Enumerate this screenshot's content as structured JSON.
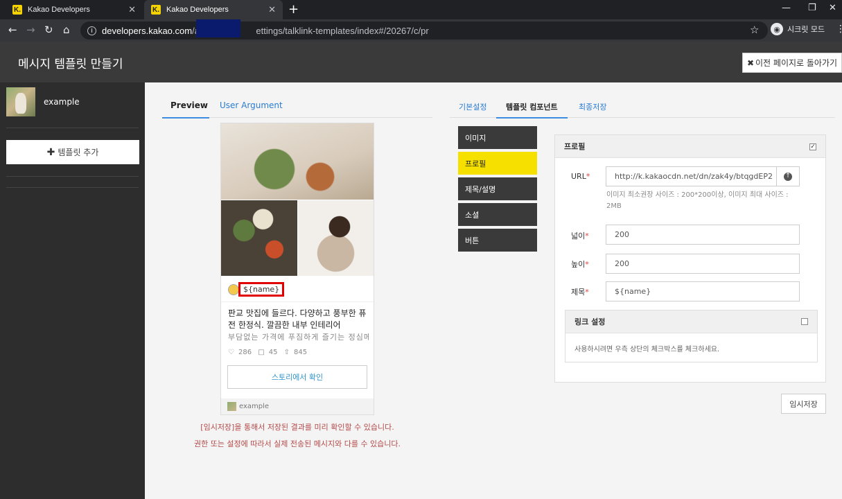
{
  "browser": {
    "tabs": [
      {
        "favicon": "K.",
        "title": "Kakao Developers",
        "close": "✕"
      },
      {
        "favicon": "K.",
        "title": "Kakao Developers",
        "close": "✕"
      }
    ],
    "new_tab": "+",
    "url_host": "developers.kakao.com",
    "url_path_start": "/app",
    "url_path_end": "ettings/talklink-templates/index#/20267/c/pr",
    "incognito_label": "시크릿 모드"
  },
  "header": {
    "title": "메시지 템플릿 만들기",
    "back_button": "이전 페이지로 돌아가기"
  },
  "sidebar": {
    "user_name": "example",
    "add_template": "템플릿 추가"
  },
  "preview": {
    "tabs": [
      "Preview",
      "User Argument"
    ],
    "profile_name": "${name}",
    "title": "판교 맛집에 들르다. 다양하고 풍부한 퓨전 한정식. 깔끔한 내부 인테리어",
    "description": "부담없는 가격에 푸짐하게 즐기는 정심메뉴",
    "likes": "286",
    "comments": "45",
    "shares": "845",
    "story_button": "스토리에서 확인",
    "footer_name": "example",
    "notice_1": "[임시저장]을 통해서 저장된 결과를 미리 확인할 수 있습니다.",
    "notice_2": "권한 또는 설정에 따라서 실제 전송된 메시지와 다를 수 있습니다."
  },
  "settings": {
    "tabs": [
      "기본설정",
      "템플릿 컴포넌트",
      "최종저장"
    ],
    "components": [
      "이미지",
      "프로필",
      "제목/설명",
      "소셜",
      "버튼"
    ],
    "active_component": "프로필",
    "panel_title": "프로필",
    "panel_checked": true,
    "fields": {
      "url_label": "URL",
      "url_value": "http://k.kakaocdn.net/dn/zak4y/btqgdEP2",
      "url_hint": "이미지 최소권장 사이즈 : 200*200이상, 이미지 최대 사이즈 : 2MB",
      "width_label": "넓이",
      "width_value": "200",
      "height_label": "높이",
      "height_value": "200",
      "title_label": "제목",
      "title_value": "${name}",
      "required_mark": "*"
    },
    "link": {
      "title": "링크 설정",
      "checked": false,
      "body": "사용하시려면 우측 상단의 체크박스를 체크하세요."
    },
    "temp_save": "임시저장"
  },
  "colors": {
    "accent_yellow": "#f5e000",
    "link_blue": "#2a7bd0",
    "highlight_red": "#e00000"
  }
}
